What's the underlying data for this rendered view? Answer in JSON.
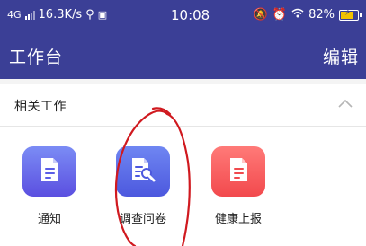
{
  "status_bar": {
    "network": "4G",
    "speed": "16.3K/s",
    "time": "10:08",
    "battery_percent": "82%",
    "battery_level": 0.82
  },
  "header": {
    "title": "工作台",
    "edit_label": "编辑"
  },
  "section": {
    "title": "相关工作"
  },
  "apps": [
    {
      "label": "通知",
      "icon": "document-icon",
      "color_top": "#7b8cf5",
      "color_bottom": "#5b4fe0"
    },
    {
      "label": "调查问卷",
      "icon": "document-search-icon",
      "color_top": "#6f86f2",
      "color_bottom": "#4c58de"
    },
    {
      "label": "健康上报",
      "icon": "document-icon",
      "color_top": "#ff7a78",
      "color_bottom": "#f2494d"
    }
  ],
  "colors": {
    "header_bg": "#3b3f96",
    "annotation": "#d0191f"
  }
}
